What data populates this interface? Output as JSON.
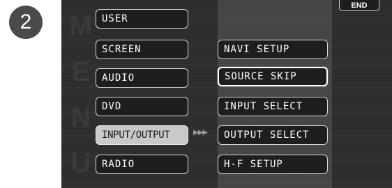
{
  "step": {
    "number": "2"
  },
  "watermark": {
    "letters": [
      "M",
      "E",
      "N",
      "U"
    ]
  },
  "end_button": {
    "label": "END"
  },
  "main_menu": [
    {
      "label": "USER"
    },
    {
      "label": "SCREEN"
    },
    {
      "label": "AUDIO"
    },
    {
      "label": "DVD"
    },
    {
      "label": "INPUT/OUTPUT",
      "state": "selected"
    },
    {
      "label": "RADIO"
    }
  ],
  "submenu_indicator": "▶▶▶",
  "sub_menu": [
    {
      "label": "NAVI SETUP"
    },
    {
      "label": "SOURCE SKIP",
      "state": "focused"
    },
    {
      "label": "INPUT SELECT"
    },
    {
      "label": "OUTPUT SELECT"
    },
    {
      "label": "H-F SETUP"
    }
  ]
}
